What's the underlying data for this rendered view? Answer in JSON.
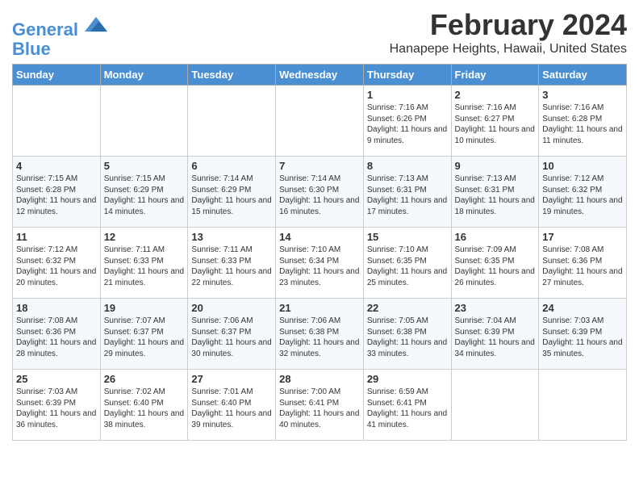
{
  "header": {
    "logo_line1": "General",
    "logo_line2": "Blue",
    "month": "February 2024",
    "location": "Hanapepe Heights, Hawaii, United States"
  },
  "weekdays": [
    "Sunday",
    "Monday",
    "Tuesday",
    "Wednesday",
    "Thursday",
    "Friday",
    "Saturday"
  ],
  "weeks": [
    [
      {
        "day": "",
        "info": ""
      },
      {
        "day": "",
        "info": ""
      },
      {
        "day": "",
        "info": ""
      },
      {
        "day": "",
        "info": ""
      },
      {
        "day": "1",
        "info": "Sunrise: 7:16 AM\nSunset: 6:26 PM\nDaylight: 11 hours\nand 9 minutes."
      },
      {
        "day": "2",
        "info": "Sunrise: 7:16 AM\nSunset: 6:27 PM\nDaylight: 11 hours\nand 10 minutes."
      },
      {
        "day": "3",
        "info": "Sunrise: 7:16 AM\nSunset: 6:28 PM\nDaylight: 11 hours\nand 11 minutes."
      }
    ],
    [
      {
        "day": "4",
        "info": "Sunrise: 7:15 AM\nSunset: 6:28 PM\nDaylight: 11 hours\nand 12 minutes."
      },
      {
        "day": "5",
        "info": "Sunrise: 7:15 AM\nSunset: 6:29 PM\nDaylight: 11 hours\nand 14 minutes."
      },
      {
        "day": "6",
        "info": "Sunrise: 7:14 AM\nSunset: 6:29 PM\nDaylight: 11 hours\nand 15 minutes."
      },
      {
        "day": "7",
        "info": "Sunrise: 7:14 AM\nSunset: 6:30 PM\nDaylight: 11 hours\nand 16 minutes."
      },
      {
        "day": "8",
        "info": "Sunrise: 7:13 AM\nSunset: 6:31 PM\nDaylight: 11 hours\nand 17 minutes."
      },
      {
        "day": "9",
        "info": "Sunrise: 7:13 AM\nSunset: 6:31 PM\nDaylight: 11 hours\nand 18 minutes."
      },
      {
        "day": "10",
        "info": "Sunrise: 7:12 AM\nSunset: 6:32 PM\nDaylight: 11 hours\nand 19 minutes."
      }
    ],
    [
      {
        "day": "11",
        "info": "Sunrise: 7:12 AM\nSunset: 6:32 PM\nDaylight: 11 hours\nand 20 minutes."
      },
      {
        "day": "12",
        "info": "Sunrise: 7:11 AM\nSunset: 6:33 PM\nDaylight: 11 hours\nand 21 minutes."
      },
      {
        "day": "13",
        "info": "Sunrise: 7:11 AM\nSunset: 6:33 PM\nDaylight: 11 hours\nand 22 minutes."
      },
      {
        "day": "14",
        "info": "Sunrise: 7:10 AM\nSunset: 6:34 PM\nDaylight: 11 hours\nand 23 minutes."
      },
      {
        "day": "15",
        "info": "Sunrise: 7:10 AM\nSunset: 6:35 PM\nDaylight: 11 hours\nand 25 minutes."
      },
      {
        "day": "16",
        "info": "Sunrise: 7:09 AM\nSunset: 6:35 PM\nDaylight: 11 hours\nand 26 minutes."
      },
      {
        "day": "17",
        "info": "Sunrise: 7:08 AM\nSunset: 6:36 PM\nDaylight: 11 hours\nand 27 minutes."
      }
    ],
    [
      {
        "day": "18",
        "info": "Sunrise: 7:08 AM\nSunset: 6:36 PM\nDaylight: 11 hours\nand 28 minutes."
      },
      {
        "day": "19",
        "info": "Sunrise: 7:07 AM\nSunset: 6:37 PM\nDaylight: 11 hours\nand 29 minutes."
      },
      {
        "day": "20",
        "info": "Sunrise: 7:06 AM\nSunset: 6:37 PM\nDaylight: 11 hours\nand 30 minutes."
      },
      {
        "day": "21",
        "info": "Sunrise: 7:06 AM\nSunset: 6:38 PM\nDaylight: 11 hours\nand 32 minutes."
      },
      {
        "day": "22",
        "info": "Sunrise: 7:05 AM\nSunset: 6:38 PM\nDaylight: 11 hours\nand 33 minutes."
      },
      {
        "day": "23",
        "info": "Sunrise: 7:04 AM\nSunset: 6:39 PM\nDaylight: 11 hours\nand 34 minutes."
      },
      {
        "day": "24",
        "info": "Sunrise: 7:03 AM\nSunset: 6:39 PM\nDaylight: 11 hours\nand 35 minutes."
      }
    ],
    [
      {
        "day": "25",
        "info": "Sunrise: 7:03 AM\nSunset: 6:39 PM\nDaylight: 11 hours\nand 36 minutes."
      },
      {
        "day": "26",
        "info": "Sunrise: 7:02 AM\nSunset: 6:40 PM\nDaylight: 11 hours\nand 38 minutes."
      },
      {
        "day": "27",
        "info": "Sunrise: 7:01 AM\nSunset: 6:40 PM\nDaylight: 11 hours\nand 39 minutes."
      },
      {
        "day": "28",
        "info": "Sunrise: 7:00 AM\nSunset: 6:41 PM\nDaylight: 11 hours\nand 40 minutes."
      },
      {
        "day": "29",
        "info": "Sunrise: 6:59 AM\nSunset: 6:41 PM\nDaylight: 11 hours\nand 41 minutes."
      },
      {
        "day": "",
        "info": ""
      },
      {
        "day": "",
        "info": ""
      }
    ]
  ]
}
